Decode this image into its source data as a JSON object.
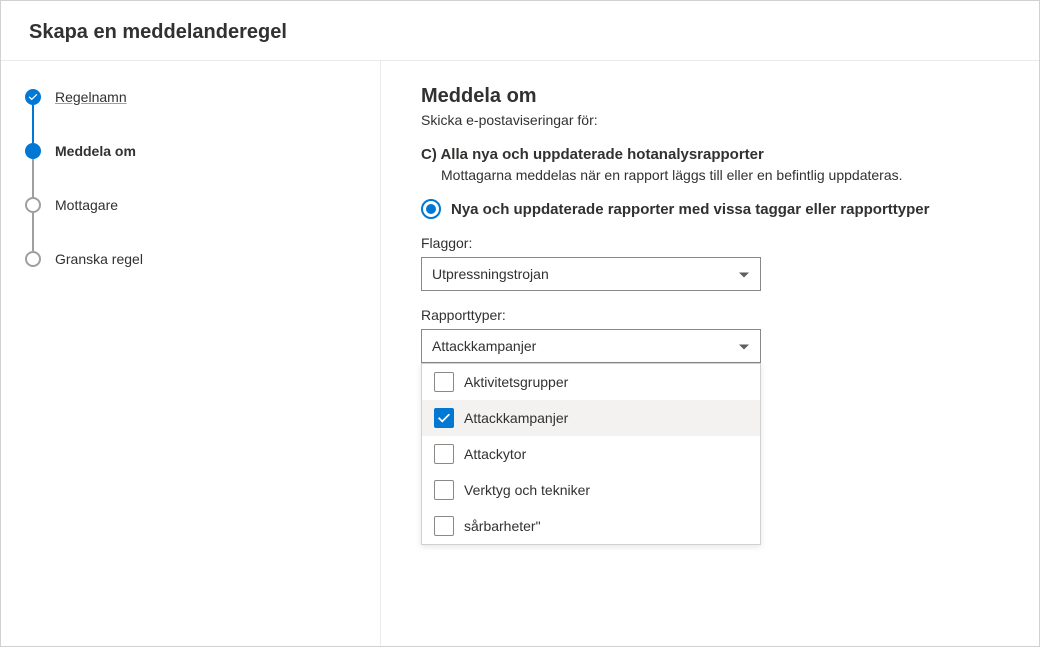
{
  "header": {
    "title": "Skapa en meddelanderegel"
  },
  "sidebar": {
    "steps": [
      {
        "label": "Regelnamn",
        "state": "completed"
      },
      {
        "label": "Meddela om",
        "state": "active"
      },
      {
        "label": "Mottagare",
        "state": "pending"
      },
      {
        "label": "Granska regel",
        "state": "pending"
      }
    ]
  },
  "main": {
    "title": "Meddela om",
    "subtitle": "Skicka e-postaviseringar för:",
    "option_c": {
      "heading": "C) Alla nya och uppdaterade hotanalysrapporter",
      "desc": "Mottagarna meddelas när en rapport läggs till eller en befintlig uppdateras."
    },
    "radio": {
      "label": "Nya och uppdaterade rapporter med vissa taggar eller rapporttyper"
    },
    "flags": {
      "label": "Flaggor:",
      "value": "Utpressningstrojan"
    },
    "report_types": {
      "label": "Rapporttyper:",
      "value": "Attackkampanjer",
      "options": [
        {
          "label": "Aktivitetsgrupper",
          "checked": false
        },
        {
          "label": "Attackkampanjer",
          "checked": true
        },
        {
          "label": "Attackytor",
          "checked": false
        },
        {
          "label": "Verktyg och tekniker",
          "checked": false
        },
        {
          "label": "sårbarheter\"",
          "checked": false
        }
      ]
    }
  }
}
